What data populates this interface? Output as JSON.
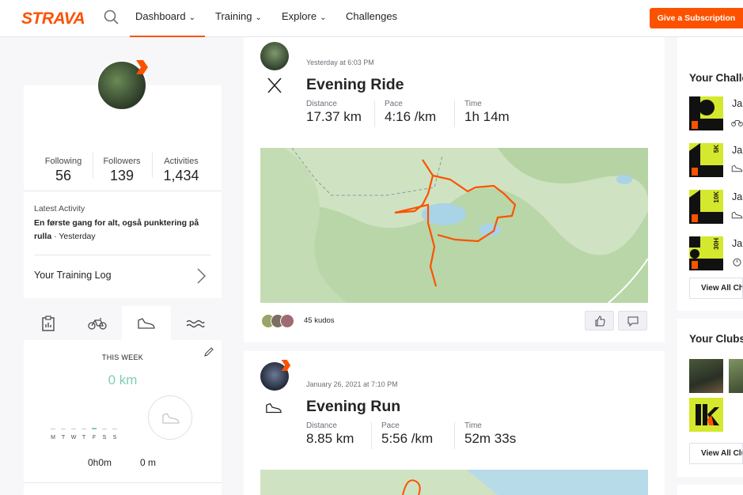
{
  "nav": {
    "logo": "STRAVA",
    "items": [
      "Dashboard",
      "Training",
      "Explore",
      "Challenges"
    ],
    "subscription_button": "Give a Subscription"
  },
  "profile": {
    "stats": [
      {
        "label": "Following",
        "value": "56"
      },
      {
        "label": "Followers",
        "value": "139"
      },
      {
        "label": "Activities",
        "value": "1,434"
      }
    ],
    "latest_activity_label": "Latest Activity",
    "latest_activity_title": "En første gang for alt, også punktering på rulla",
    "latest_activity_when": " · Yesterday",
    "training_log": "Your Training Log"
  },
  "week": {
    "title": "THIS WEEK",
    "distance": "0 km",
    "days": [
      "M",
      "T",
      "W",
      "T",
      "F",
      "S",
      "S"
    ],
    "time": "0h0m",
    "elevation": "0 m"
  },
  "feed": [
    {
      "timestamp": "Yesterday at 6:03 PM",
      "title": "Evening Ride",
      "stats": [
        {
          "label": "Distance",
          "value": "17.37 km"
        },
        {
          "label": "Pace",
          "value": "4:16 /km"
        },
        {
          "label": "Time",
          "value": "1h 14m"
        }
      ],
      "kudos": "45 kudos"
    },
    {
      "timestamp": "January 26, 2021 at 7:10 PM",
      "title": "Evening Run",
      "stats": [
        {
          "label": "Distance",
          "value": "8.85 km"
        },
        {
          "label": "Pace",
          "value": "5:56 /km"
        },
        {
          "label": "Time",
          "value": "52m 33s"
        }
      ]
    }
  ],
  "right": {
    "challenges_title": "Your Challenges",
    "challenges": [
      {
        "name": "Ja",
        "badge": ""
      },
      {
        "name": "Ja",
        "badge": "5K"
      },
      {
        "name": "Ja",
        "badge": "10K"
      },
      {
        "name": "Ja",
        "badge": "30H"
      }
    ],
    "view_all_challenges": "View All Challenges",
    "clubs_title": "Your Clubs",
    "view_all_clubs": "View All Clubs"
  },
  "colors": {
    "brand": "#fc5200",
    "week_accent": "#7dcfb6",
    "route": "#fc5200"
  }
}
